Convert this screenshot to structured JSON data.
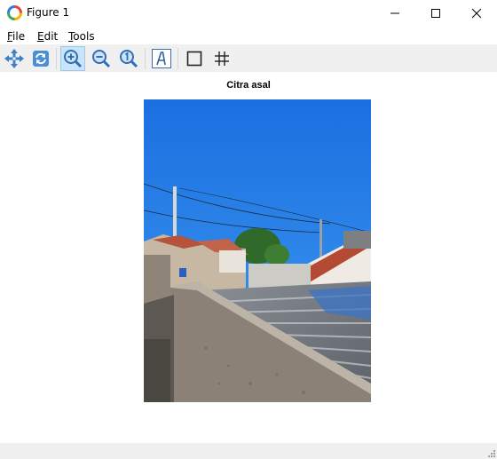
{
  "window": {
    "title": "Figure 1"
  },
  "menubar": {
    "items": [
      {
        "accel": "F",
        "rest": "ile"
      },
      {
        "accel": "E",
        "rest": "dit"
      },
      {
        "accel": "T",
        "rest": "ools"
      }
    ]
  },
  "toolbar": {
    "buttons": [
      {
        "icon": "pan-move-icon",
        "active": false
      },
      {
        "icon": "reset-view-icon",
        "active": false
      },
      {
        "icon": "zoom-in-icon",
        "active": true
      },
      {
        "icon": "zoom-out-icon",
        "active": false
      },
      {
        "icon": "zoom-reset-icon",
        "active": false
      },
      {
        "icon": "text-annotation-icon",
        "active": false
      },
      {
        "icon": "axes-box-icon",
        "active": false
      },
      {
        "icon": "grid-toggle-icon",
        "active": false
      }
    ]
  },
  "figure": {
    "title": "Citra asal",
    "image_alt": "Photo of a house rooftop with a concrete wall under a blue sky"
  },
  "colors": {
    "toolbar_bg": "#f0f0f0",
    "active_button": "#cce4f7",
    "sky": "#1f7fe8"
  }
}
